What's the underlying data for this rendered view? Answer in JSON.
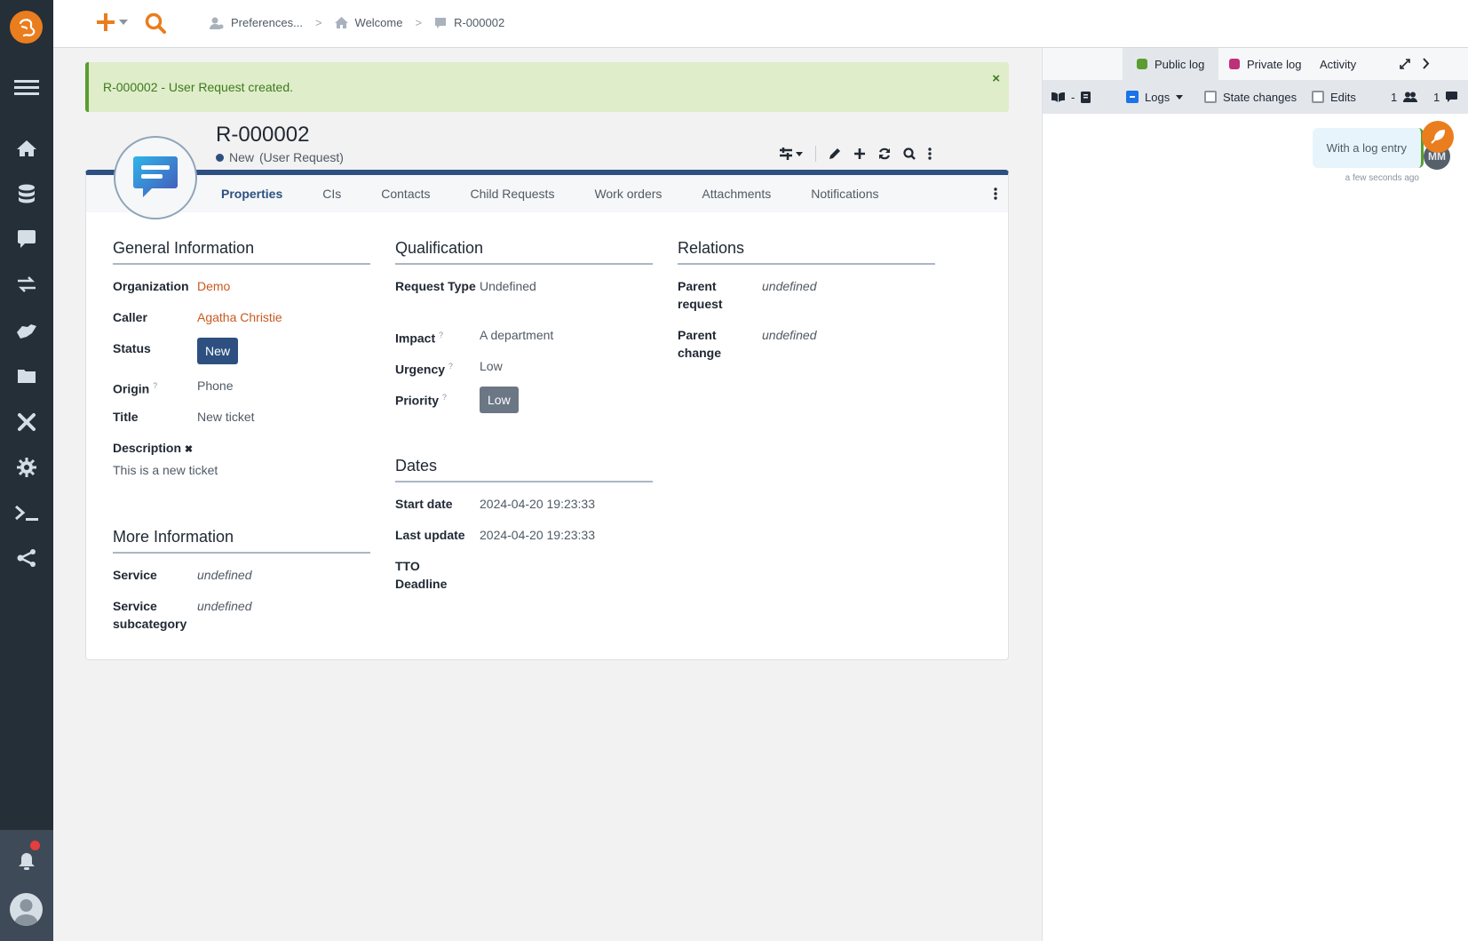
{
  "breadcrumb": [
    {
      "label": "Preferences...",
      "icon": "user-gear-icon"
    },
    {
      "label": "Welcome",
      "icon": "home-icon"
    },
    {
      "label": "R-000002",
      "icon": "comment-icon"
    }
  ],
  "sidebar": {
    "items": [
      {
        "icon": "menu-icon"
      },
      {
        "icon": "home-icon"
      },
      {
        "icon": "database-icon"
      },
      {
        "icon": "comment-icon"
      },
      {
        "icon": "exchange-icon"
      },
      {
        "icon": "handshake-icon"
      },
      {
        "icon": "folder-icon"
      },
      {
        "icon": "tools-icon"
      },
      {
        "icon": "gear-icon"
      },
      {
        "icon": "terminal-icon"
      },
      {
        "icon": "share-icon"
      }
    ],
    "notifications": "bell-icon"
  },
  "alert": {
    "message": "R-000002 - User Request created.",
    "close": "×"
  },
  "object": {
    "ref": "R-000002",
    "status": "New",
    "class": "(User Request)",
    "status_color": "#2d5080"
  },
  "tabs": [
    {
      "label": "Properties",
      "active": true
    },
    {
      "label": "CIs"
    },
    {
      "label": "Contacts"
    },
    {
      "label": "Child Requests"
    },
    {
      "label": "Work orders"
    },
    {
      "label": "Attachments"
    },
    {
      "label": "Notifications"
    }
  ],
  "general": {
    "title": "General Information",
    "fields": {
      "organization": {
        "label": "Organization",
        "value": "Demo"
      },
      "caller": {
        "label": "Caller",
        "value": "Agatha Christie"
      },
      "status": {
        "label": "Status",
        "value": "New"
      },
      "origin": {
        "label": "Origin",
        "value": "Phone"
      },
      "title": {
        "label": "Title",
        "value": "New ticket"
      },
      "description": {
        "label": "Description",
        "value": "This is a new ticket"
      }
    }
  },
  "more": {
    "title": "More Information",
    "fields": {
      "service": {
        "label": "Service",
        "value": "undefined"
      },
      "subcategory": {
        "label": "Service subcategory",
        "value": "undefined"
      }
    }
  },
  "qualification": {
    "title": "Qualification",
    "fields": {
      "request_type": {
        "label": "Request Type",
        "value": "Undefined"
      },
      "impact": {
        "label": "Impact",
        "value": "A department"
      },
      "urgency": {
        "label": "Urgency",
        "value": "Low"
      },
      "priority": {
        "label": "Priority",
        "value": "Low"
      }
    }
  },
  "dates": {
    "title": "Dates",
    "fields": {
      "start": {
        "label": "Start date",
        "value": "2024-04-20 19:23:33"
      },
      "update": {
        "label": "Last update",
        "value": "2024-04-20 19:23:33"
      },
      "tto": {
        "label": "TTO Deadline",
        "value": ""
      }
    }
  },
  "relations": {
    "title": "Relations",
    "fields": {
      "parent_request": {
        "label": "Parent request",
        "value": "undefined"
      },
      "parent_change": {
        "label": "Parent change",
        "value": "undefined"
      }
    }
  },
  "log": {
    "tabs": [
      {
        "label": "Public log",
        "color": "#5b9d30"
      },
      {
        "label": "Private log",
        "color": "#c0307a"
      },
      {
        "label": "Activity"
      }
    ],
    "toolbar": {
      "sep": "-",
      "logs": "Logs",
      "state_changes": "State changes",
      "edits": "Edits",
      "users_count": "1",
      "messages_count": "1"
    },
    "entries": [
      {
        "text": "With a log entry",
        "time": "a few seconds ago",
        "author": "MM"
      }
    ]
  }
}
